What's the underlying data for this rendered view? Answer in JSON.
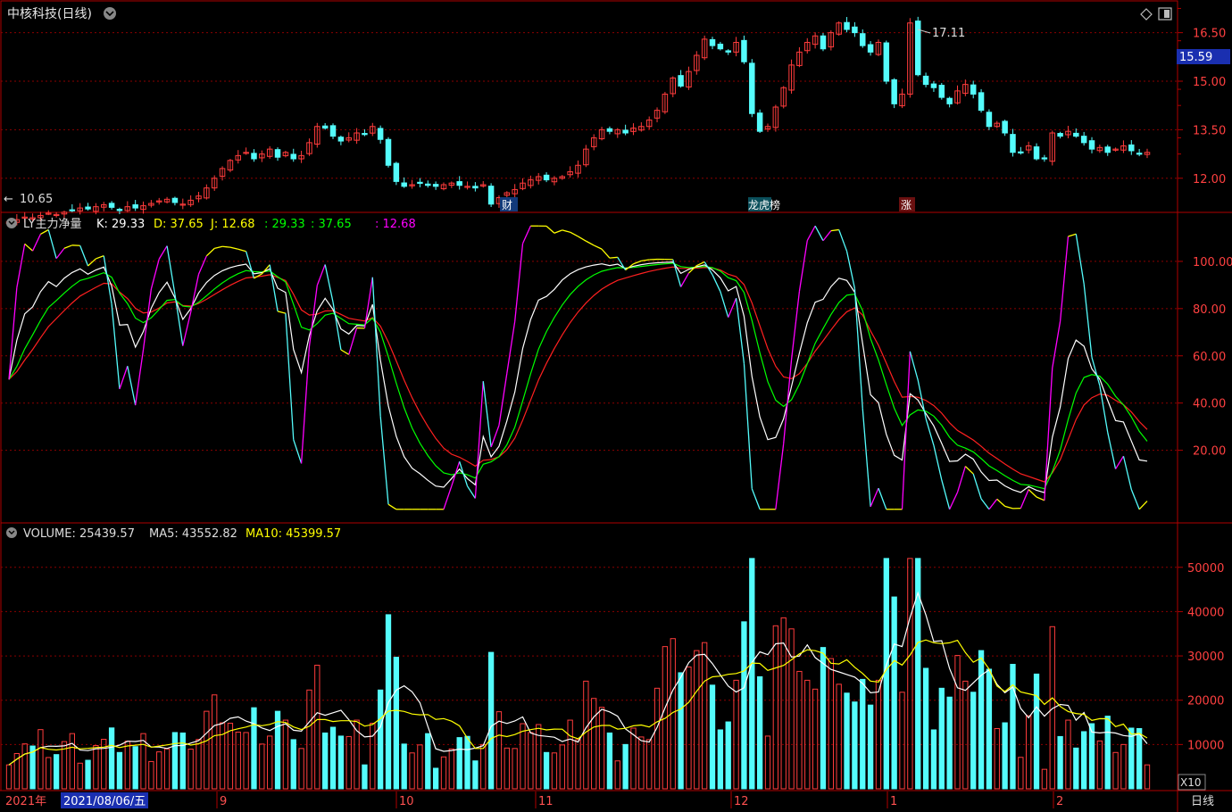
{
  "header": {
    "stock_title": "中核科技(日线)",
    "high_marker": "17.11",
    "low_marker": "10.65",
    "current_price": "15.59",
    "event_tags": [
      "财",
      "龙虎榜",
      "涨"
    ]
  },
  "kdj_panel": {
    "name": "LY主力净量",
    "k_label": "K: 29.33",
    "d_label": "D: 37.65",
    "j_label": "J: 12.68",
    "extra1": ": 29.33",
    "extra2": ": 37.65",
    "extra3": ": 12.68"
  },
  "volume_panel": {
    "name": "VOLUME: 25439.57",
    "ma5_label": "MA5: 43552.82",
    "ma10_label": "MA10: 45399.57",
    "unit": "X10"
  },
  "bottom_bar": {
    "year": "2021年",
    "date": "2021/08/06/五",
    "period": "日线",
    "month_labels": [
      "9",
      "10",
      "11",
      "12",
      "1",
      "2"
    ]
  },
  "colors": {
    "up": "#ff3c3c",
    "down": "#54fcfc",
    "grid": "#8b0000",
    "k": "#ffffff",
    "d": "#ffff00",
    "j": "#ff00ff",
    "ma": "#00ff00"
  },
  "chart_data": [
    {
      "type": "candlestick",
      "title": "中核科技(日线)",
      "ylim": [
        11.0,
        17.4
      ],
      "y_ticks": [
        12.0,
        13.5,
        15.0,
        16.5
      ],
      "high": 17.11,
      "low": 10.65,
      "last": 15.59,
      "close": [
        10.65,
        10.72,
        10.8,
        10.78,
        10.85,
        10.92,
        10.88,
        10.95,
        11.02,
        11.08,
        11.05,
        11.12,
        11.18,
        11.1,
        11.0,
        11.12,
        11.08,
        11.15,
        11.22,
        11.3,
        11.35,
        11.25,
        11.2,
        11.32,
        11.45,
        11.7,
        12.0,
        12.3,
        12.55,
        12.7,
        12.8,
        12.6,
        12.75,
        12.9,
        12.65,
        12.8,
        12.6,
        12.7,
        13.1,
        13.6,
        13.55,
        13.3,
        13.15,
        13.25,
        13.4,
        13.35,
        13.6,
        13.2,
        12.4,
        11.9,
        11.75,
        11.8,
        11.85,
        11.78,
        11.75,
        11.8,
        11.85,
        11.78,
        11.75,
        11.7,
        11.8,
        11.2,
        11.4,
        11.55,
        11.65,
        11.85,
        11.95,
        12.05,
        11.95,
        12.0,
        12.05,
        12.2,
        12.4,
        12.9,
        13.25,
        13.5,
        13.45,
        13.5,
        13.4,
        13.55,
        13.6,
        13.8,
        14.1,
        14.6,
        15.1,
        14.85,
        15.3,
        15.8,
        16.3,
        16.1,
        16.0,
        15.9,
        16.2,
        15.6,
        14.0,
        13.45,
        13.6,
        14.2,
        14.8,
        15.5,
        15.9,
        16.2,
        16.4,
        16.0,
        16.5,
        16.8,
        16.6,
        16.5,
        16.1,
        15.9,
        16.2,
        15.0,
        14.3,
        14.6,
        16.8,
        15.2,
        14.9,
        14.8,
        14.5,
        14.3,
        14.7,
        14.9,
        14.6,
        14.1,
        13.6,
        13.7,
        13.4,
        12.8,
        12.8,
        13.0,
        12.6,
        12.6,
        13.4,
        13.3,
        13.45,
        13.3,
        13.1,
        12.9,
        12.95,
        12.8,
        12.9,
        13.0,
        12.85,
        12.75,
        12.8
      ]
    },
    {
      "type": "line",
      "title": "LY主力净量",
      "ylim": [
        -10,
        120
      ],
      "y_ticks": [
        20,
        40,
        60,
        80,
        100
      ],
      "series": [
        {
          "name": "K",
          "last": 29.33
        },
        {
          "name": "D",
          "last": 37.65
        },
        {
          "name": "J",
          "last": 12.68
        }
      ]
    },
    {
      "type": "bar",
      "title": "VOLUME",
      "unit": "X10",
      "ylim": [
        0,
        56000
      ],
      "y_ticks": [
        10000,
        20000,
        30000,
        40000,
        50000
      ],
      "last": 25439.57,
      "ma5_last": 43552.82,
      "ma10_last": 45399.57
    }
  ]
}
